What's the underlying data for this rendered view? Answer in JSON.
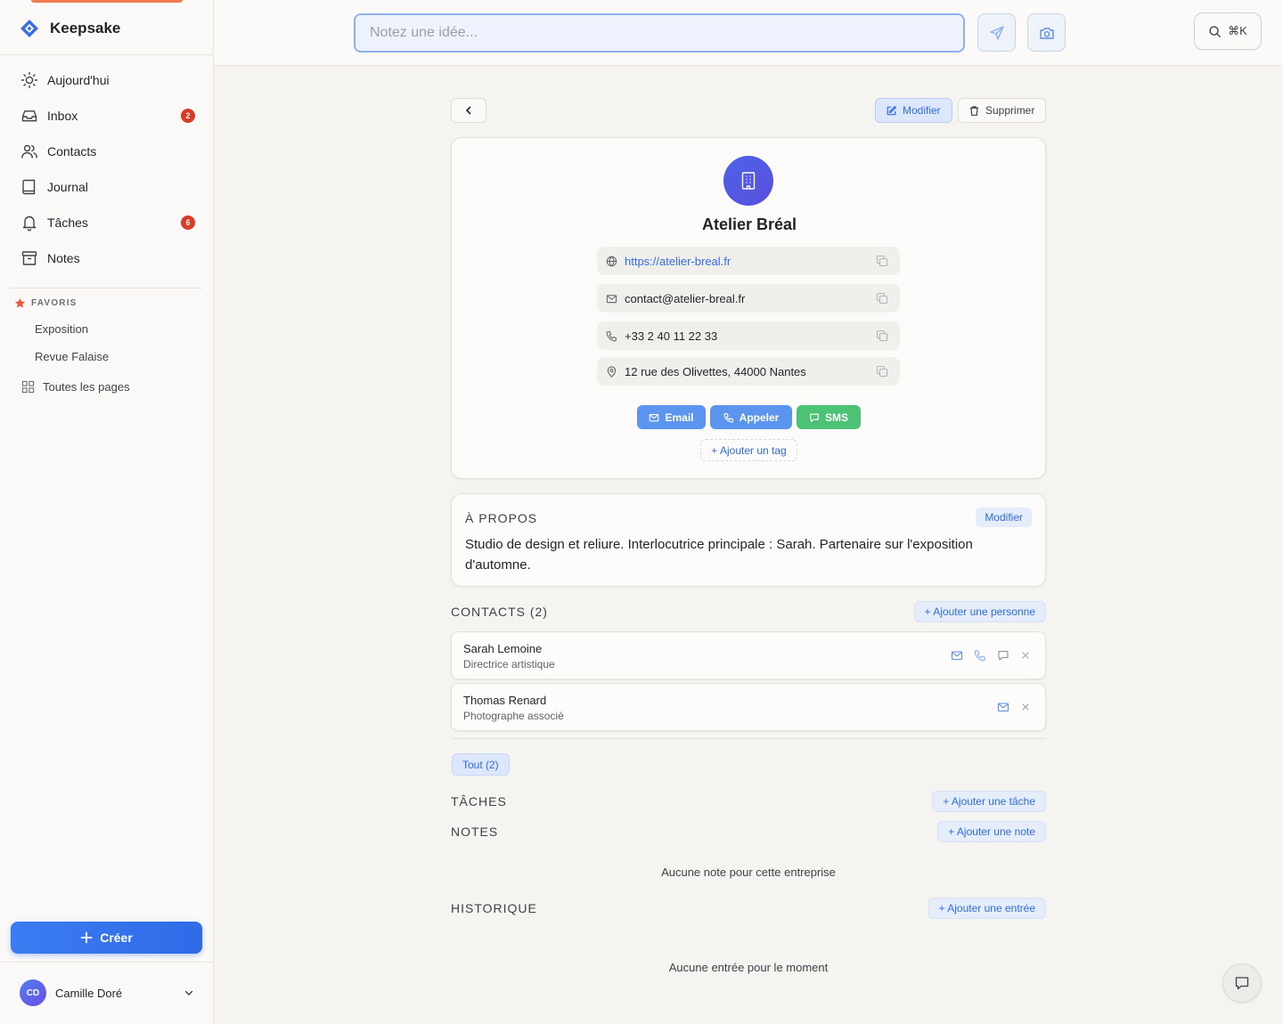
{
  "app": {
    "name": "Keepsake"
  },
  "sidebar": {
    "items": [
      {
        "label": "Aujourd'hui",
        "icon": "sun-icon"
      },
      {
        "label": "Inbox",
        "icon": "inbox-icon",
        "badge": "2"
      },
      {
        "label": "Contacts",
        "icon": "users-icon"
      },
      {
        "label": "Journal",
        "icon": "book-icon"
      },
      {
        "label": "Tâches",
        "icon": "bell-icon",
        "badge": "6"
      },
      {
        "label": "Notes",
        "icon": "archive-icon"
      }
    ],
    "favorites_title": "FAVORIS",
    "favorites": [
      "Exposition",
      "Revue Falaise"
    ],
    "all_pages": "Toutes les pages",
    "create_label": "Créer",
    "user": {
      "initials": "CD",
      "name": "Camille Doré"
    }
  },
  "topbar": {
    "quick_placeholder": "Notez une idée...",
    "shortcut": "⌘K"
  },
  "actions": {
    "edit": "Modifier",
    "delete": "Supprimer"
  },
  "company": {
    "name": "Atelier Bréal",
    "website": "https://atelier-breal.fr",
    "email": "contact@atelier-breal.fr",
    "phone": "+33 2 40 11 22 33",
    "address": "12 rue des Olivettes, 44000 Nantes",
    "cta": {
      "email": "Email",
      "call": "Appeler",
      "sms": "SMS"
    },
    "add_tag": "+ Ajouter un tag"
  },
  "about": {
    "title": "À PROPOS",
    "edit": "Modifier",
    "text": "Studio de design et reliure. Interlocutrice principale : Sarah. Partenaire sur l'exposition d'automne."
  },
  "contacts": {
    "title": "CONTACTS (2)",
    "add": "+ Ajouter une personne",
    "people": [
      {
        "name": "Sarah Lemoine",
        "role": "Directrice artistique"
      },
      {
        "name": "Thomas Renard",
        "role": "Photographe associé"
      }
    ]
  },
  "filter": {
    "all": "Tout (2)"
  },
  "tasks": {
    "title": "TÂCHES",
    "add": "+ Ajouter une tâche"
  },
  "notes": {
    "title": "NOTES",
    "add": "+ Ajouter une note",
    "empty": "Aucune note pour cette entreprise"
  },
  "history": {
    "title": "HISTORIQUE",
    "add": "+ Ajouter une entrée",
    "empty": "Aucune entrée pour le moment"
  },
  "colors": {
    "accent": "#2f6be8",
    "badge": "#d93a26",
    "sms": "#4cc274",
    "brand": "#3b6fe0"
  }
}
